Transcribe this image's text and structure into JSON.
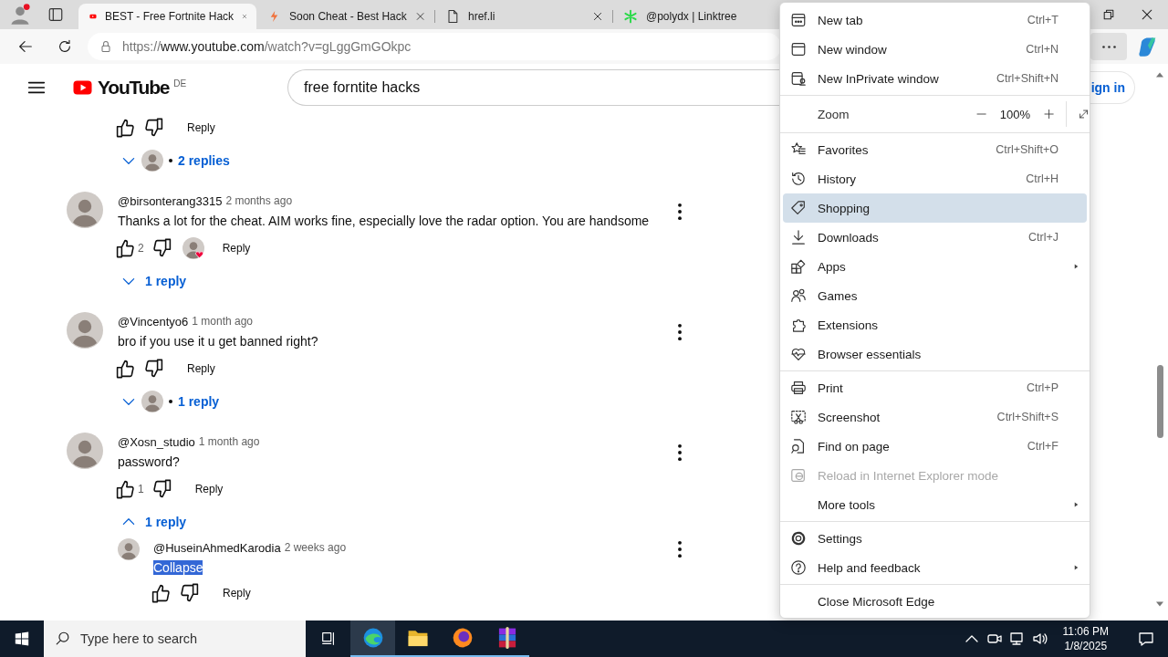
{
  "browser": {
    "tabs": [
      {
        "title": "BEST - Free Fortnite Hack",
        "selected": true,
        "cut_off": false
      },
      {
        "title": "Soon Cheat - Best Hack",
        "selected": false,
        "cut_off": false
      },
      {
        "title": "href.li",
        "selected": false,
        "cut_off": false
      },
      {
        "title": "@polydx | Linktree",
        "selected": false,
        "cut_off": true
      }
    ],
    "address": {
      "scheme": "https://",
      "host": "www.youtube.com",
      "path": "/watch?v=gLggGmGOkpc"
    }
  },
  "youtube": {
    "logo_text": "YouTube",
    "region": "DE",
    "search": {
      "value": "free forntite hacks"
    },
    "sign_in": "ign in",
    "comments": [
      {
        "hearted": false,
        "reply_label": "Reply",
        "replies": {
          "label": "2 replies",
          "expanded": false,
          "creator_avatar": true
        }
      },
      {
        "author": "@birsonterang3315",
        "time": "2 months ago",
        "text": "Thanks a lot for the cheat. AIM works fine, especially love the radar option. You are handsome",
        "text_selected": false,
        "likes": "2",
        "hearted": true,
        "reply_label": "Reply",
        "replies": {
          "label": "1 reply",
          "expanded": false,
          "creator_avatar": false
        }
      },
      {
        "author": "@Vincentyo6",
        "time": "1 month ago",
        "text": "bro if you use it u get banned right?",
        "text_selected": false,
        "hearted": false,
        "reply_label": "Reply",
        "replies": {
          "label": "1 reply",
          "expanded": false,
          "creator_avatar": true
        }
      },
      {
        "author": "@Xosn_studio",
        "time": "1 month ago",
        "text": "password?",
        "text_selected": false,
        "likes": "1",
        "hearted": false,
        "reply_label": "Reply",
        "replies": {
          "label": "1 reply",
          "expanded": true,
          "creator_avatar": false
        },
        "children": [
          {
            "author": "@HuseinAhmedKarodia",
            "time": "2 weeks ago",
            "text": "Collapse",
            "text_selected": true,
            "hearted": false,
            "reply_label": "Reply"
          }
        ]
      }
    ]
  },
  "menu": {
    "items": [
      {
        "kind": "item",
        "label": "New tab",
        "shortcut": "Ctrl+T",
        "selected": false,
        "disabled": false,
        "submenu": false
      },
      {
        "kind": "item",
        "label": "New window",
        "shortcut": "Ctrl+N",
        "selected": false,
        "disabled": false,
        "submenu": false
      },
      {
        "kind": "item",
        "label": "New InPrivate window",
        "shortcut": "Ctrl+Shift+N",
        "selected": false,
        "disabled": false,
        "submenu": false
      },
      {
        "kind": "divider"
      },
      {
        "kind": "zoom",
        "label": "Zoom",
        "value": "100%"
      },
      {
        "kind": "divider"
      },
      {
        "kind": "item",
        "label": "Favorites",
        "shortcut": "Ctrl+Shift+O",
        "selected": false,
        "disabled": false,
        "submenu": false
      },
      {
        "kind": "item",
        "label": "History",
        "shortcut": "Ctrl+H",
        "selected": false,
        "disabled": false,
        "submenu": false
      },
      {
        "kind": "item",
        "label": "Shopping",
        "selected": true,
        "disabled": false,
        "submenu": false
      },
      {
        "kind": "item",
        "label": "Downloads",
        "shortcut": "Ctrl+J",
        "selected": false,
        "disabled": false,
        "submenu": false
      },
      {
        "kind": "item",
        "label": "Apps",
        "selected": false,
        "disabled": false,
        "submenu": true
      },
      {
        "kind": "item",
        "label": "Games",
        "selected": false,
        "disabled": false,
        "submenu": false
      },
      {
        "kind": "item",
        "label": "Extensions",
        "selected": false,
        "disabled": false,
        "submenu": false
      },
      {
        "kind": "item",
        "label": "Browser essentials",
        "selected": false,
        "disabled": false,
        "submenu": false
      },
      {
        "kind": "divider"
      },
      {
        "kind": "item",
        "label": "Print",
        "shortcut": "Ctrl+P",
        "selected": false,
        "disabled": false,
        "submenu": false
      },
      {
        "kind": "item",
        "label": "Screenshot",
        "shortcut": "Ctrl+Shift+S",
        "selected": false,
        "disabled": false,
        "submenu": false
      },
      {
        "kind": "item",
        "label": "Find on page",
        "shortcut": "Ctrl+F",
        "selected": false,
        "disabled": false,
        "submenu": false
      },
      {
        "kind": "item",
        "label": "Reload in Internet Explorer mode",
        "selected": false,
        "disabled": true,
        "submenu": false
      },
      {
        "kind": "item",
        "label": "More tools",
        "selected": false,
        "disabled": false,
        "submenu": true
      },
      {
        "kind": "divider"
      },
      {
        "kind": "item",
        "label": "Settings",
        "selected": false,
        "disabled": false,
        "submenu": false
      },
      {
        "kind": "item",
        "label": "Help and feedback",
        "selected": false,
        "disabled": false,
        "submenu": true
      },
      {
        "kind": "divider"
      },
      {
        "kind": "item",
        "label": "Close Microsoft Edge",
        "selected": false,
        "disabled": false,
        "submenu": false
      }
    ]
  },
  "taskbar": {
    "search": {
      "placeholder": "Type here to search"
    },
    "apps": [
      {
        "selected": true,
        "running": true
      },
      {
        "selected": false,
        "running": true
      },
      {
        "selected": false,
        "running": true
      },
      {
        "selected": false,
        "running": true
      }
    ],
    "time": "11:06 PM",
    "date": "1/8/2025"
  }
}
